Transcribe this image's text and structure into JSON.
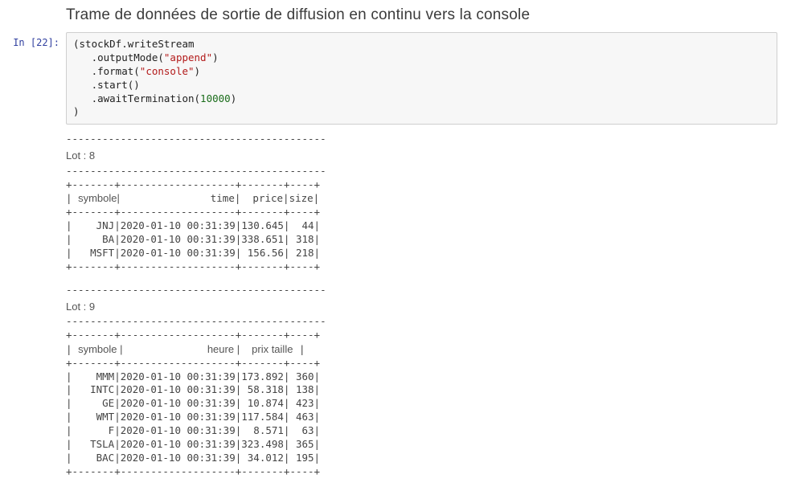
{
  "heading": "Trame de données de sortie de diffusion en continu vers la console",
  "prompt": "In [22]:",
  "code": {
    "l1a": "(stockDf.writeStream",
    "l2a": "   .outputMode(",
    "l2s": "\"append\"",
    "l2b": ")",
    "l3a": "   .format(",
    "l3s": "\"console\"",
    "l3b": ")",
    "l4": "   .start()",
    "l5a": "   .awaitTermination(",
    "l5n": "10000",
    "l5b": ")",
    "l6": ")"
  },
  "batch8": {
    "label": "Lot : 8",
    "sep": "-------------------------------------------",
    "border": "+-------+-------------------+-------+----+",
    "hdr_pre": "| ",
    "hdr_sym": "symbole|",
    "hdr_mid": "               time|  price|size|",
    "rows": [
      "|    JNJ|2020-01-10 00:31:39|130.645|  44|",
      "|     BA|2020-01-10 00:31:39|338.651| 318|",
      "|   MSFT|2020-01-10 00:31:39| 156.56| 218|"
    ]
  },
  "batch9": {
    "label": "Lot : 9",
    "sep": "-------------------------------------------",
    "border": "+-------+-------------------+-------+----+",
    "hdr_pre": "| ",
    "hdr_sym": "symbole |",
    "hdr_mid1": "              ",
    "hdr_heure": "heure |",
    "hdr_mid2": "  ",
    "hdr_prixtaille": "prix taille",
    "hdr_end": " |",
    "rows": [
      "|    MMM|2020-01-10 00:31:39|173.892| 360|",
      "|   INTC|2020-01-10 00:31:39| 58.318| 138|",
      "|     GE|2020-01-10 00:31:39| 10.874| 423|",
      "|    WMT|2020-01-10 00:31:39|117.584| 463|",
      "|      F|2020-01-10 00:31:39|  8.571|  63|",
      "|   TSLA|2020-01-10 00:31:39|323.498| 365|",
      "|    BAC|2020-01-10 00:31:39| 34.012| 195|"
    ]
  },
  "chart_data": {
    "type": "table",
    "title": "Streaming console output batches",
    "batches": [
      {
        "batch": 8,
        "columns": [
          "symbole",
          "time",
          "price",
          "size"
        ],
        "rows": [
          [
            "JNJ",
            "2020-01-10 00:31:39",
            130.645,
            44
          ],
          [
            "BA",
            "2020-01-10 00:31:39",
            338.651,
            318
          ],
          [
            "MSFT",
            "2020-01-10 00:31:39",
            156.56,
            218
          ]
        ]
      },
      {
        "batch": 9,
        "columns": [
          "symbole",
          "heure",
          "prix",
          "taille"
        ],
        "rows": [
          [
            "MMM",
            "2020-01-10 00:31:39",
            173.892,
            360
          ],
          [
            "INTC",
            "2020-01-10 00:31:39",
            58.318,
            138
          ],
          [
            "GE",
            "2020-01-10 00:31:39",
            10.874,
            423
          ],
          [
            "WMT",
            "2020-01-10 00:31:39",
            117.584,
            463
          ],
          [
            "F",
            "2020-01-10 00:31:39",
            8.571,
            63
          ],
          [
            "TSLA",
            "2020-01-10 00:31:39",
            323.498,
            365
          ],
          [
            "BAC",
            "2020-01-10 00:31:39",
            34.012,
            195
          ]
        ]
      }
    ]
  }
}
